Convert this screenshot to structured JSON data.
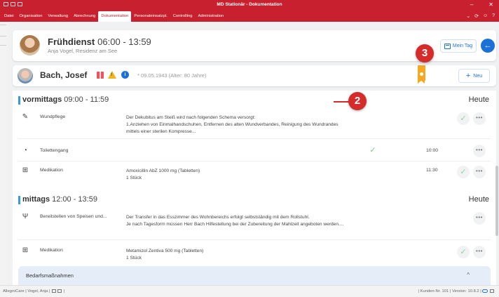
{
  "window": {
    "title": "MD Stationär - Dokumentation"
  },
  "menu": {
    "items": [
      "Datei",
      "Organisation",
      "Verwaltung",
      "Abrechnung",
      "Dokumentation",
      "Personaleinsatzpl.",
      "Controlling",
      "Administration"
    ],
    "active": "Dokumentation"
  },
  "shift": {
    "title": "Frühdienst",
    "time": "06:00 - 13:59",
    "subtitle": "Anja Vogel, Residenz am See",
    "mein_tag_label": "Mein Tag"
  },
  "resident": {
    "name": "Bach, Josef",
    "dob": "* 09.05.1943 (Alter: 80 Jahre)",
    "new_label": "Neu"
  },
  "callouts": {
    "c2": "2",
    "c3": "3"
  },
  "sections": [
    {
      "title": "vormittags",
      "time": "09:00 - 11:59",
      "today": "Heute",
      "rows": [
        {
          "icon": "wound-care-icon",
          "name": "Wundpflege",
          "desc": "Der Dekubitus am Steiß wird nach folgenden Schema versorgt:\n1.Anziehen von Einmalhandschuhen, Entfernen des alten Wundverbandes, Reinigung des Wundrandes mittels einer sterilen Kompresse...",
          "time": "",
          "done": false
        },
        {
          "icon": "toilet-icon",
          "name": "Toilettengang",
          "desc": "",
          "time": "10:00",
          "done": true
        },
        {
          "icon": "medication-icon",
          "name": "Medikation",
          "desc": "Amoxicillin AbZ 1000 mg (Tabletten)\n1 Stück",
          "time": "11:30",
          "done": false
        }
      ]
    },
    {
      "title": "mittags",
      "time": "12:00 - 13:59",
      "today": "Heute",
      "rows": [
        {
          "icon": "food-service-icon",
          "name": "Bereitstellen von Speisen und...",
          "desc": "Der Transfer in das Esszimmer des Wohnbereichs erfolgt selbstständig mit dem Rollstuhl.\nJe nach Tagesform müssen Herr Bach Hilfestellung bei der Zubereitung der Mahlzeit angeboten werden....",
          "time": "",
          "done": false
        },
        {
          "icon": "medication-icon",
          "name": "Medikation",
          "desc": "Metamizol Zentiva 500 mg (Tabletten)\n1 Stück",
          "time": "",
          "done": false
        }
      ]
    }
  ],
  "bedarf": {
    "label": "Bedarfsmaßnahmen"
  },
  "status": {
    "left": "AllegroCare | Vogel, Anja |",
    "right": "| Kunden-Nr. 101 | Version: 10.8.2 |"
  },
  "colors": {
    "brand": "#c8202e",
    "accent": "#1a72d9",
    "callout": "#d52b2b",
    "section_bar": "#3a9bd8",
    "done_check": "#78c88a"
  }
}
